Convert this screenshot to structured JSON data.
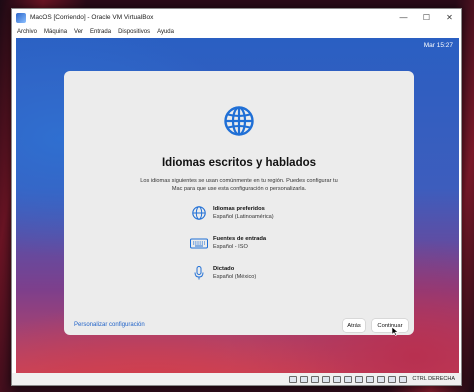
{
  "window": {
    "title": "MacOS [Corriendo] - Oracle VM VirtualBox",
    "controls": [
      "—",
      "☐",
      "✕"
    ]
  },
  "menu": [
    "Archivo",
    "Máquina",
    "Ver",
    "Entrada",
    "Dispositivos",
    "Ayuda"
  ],
  "guest": {
    "clock": "Mar 15:27",
    "dialog": {
      "heading": "Idiomas escritos y hablados",
      "description": "Los idiomas siguientes se usan comúnmente en tu región. Puedes configurar tu Mac para que use esta configuración o personalizarla.",
      "rows": [
        {
          "icon": "globe-icon",
          "title": "Idiomas preferidos",
          "value": "Español (Latinoamérica)"
        },
        {
          "icon": "keyboard-icon",
          "title": "Fuentes de entrada",
          "value": "Español - ISO"
        },
        {
          "icon": "microphone-icon",
          "title": "Dictado",
          "value": "Español (México)"
        }
      ],
      "customize_link": "Personalizar configuración",
      "back_button": "Atrás",
      "continue_button": "Continuar"
    }
  },
  "statusbar": {
    "host_key": "CTRL DERECHA"
  }
}
